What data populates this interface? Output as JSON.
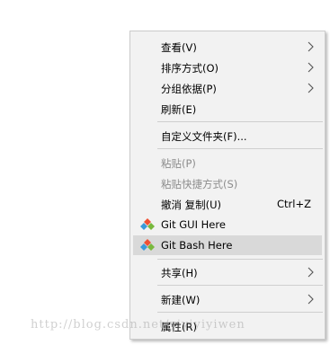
{
  "context_menu": {
    "view": "查看(V)",
    "sort_by": "排序方式(O)",
    "group_by": "分组依据(P)",
    "refresh": "刷新(E)",
    "customize_folder": "自定义文件夹(F)...",
    "paste": "粘贴(P)",
    "paste_shortcut": "粘贴快捷方式(S)",
    "undo_copy": "撤消 复制(U)",
    "undo_copy_shortcut": "Ctrl+Z",
    "git_gui": "Git GUI Here",
    "git_bash": "Git Bash Here",
    "share": "共享(H)",
    "new": "新建(W)",
    "properties": "属性(R)"
  },
  "watermark": "http://blog.csdn.net/yiyiyiyiwen",
  "colors": {
    "menu_bg": "#f2f2f2",
    "highlight": "#d9d9d9",
    "disabled_text": "#8d8d8d"
  }
}
